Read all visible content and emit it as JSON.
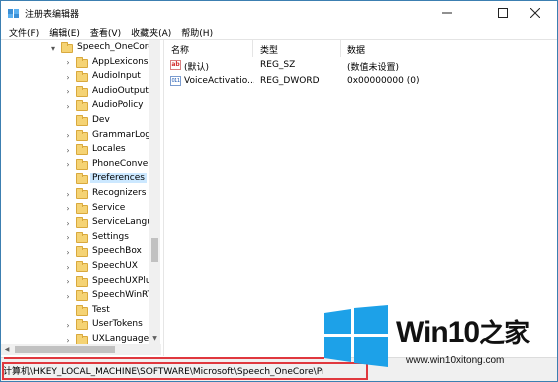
{
  "window": {
    "title": "注册表编辑器",
    "accent": "#3c7fb1"
  },
  "menu": [
    {
      "label": "文件(F)"
    },
    {
      "label": "编辑(E)"
    },
    {
      "label": "查看(V)"
    },
    {
      "label": "收藏夹(A)"
    },
    {
      "label": "帮助(H)"
    }
  ],
  "tree": {
    "parent": "Speech_OneCore",
    "children": [
      "AppLexicons",
      "AudioInput",
      "AudioOutput",
      "AudioPolicy",
      "Dev",
      "GrammarLog",
      "Locales",
      "PhoneConver",
      "Preferences",
      "Recognizers",
      "Service",
      "ServiceLangu",
      "Settings",
      "SpeechBox",
      "SpeechUX",
      "SpeechUXPlu",
      "SpeechWinRT",
      "Test",
      "UserTokens",
      "UXLanguages"
    ],
    "selected": "Preferences"
  },
  "list": {
    "headers": {
      "name": "名称",
      "type": "类型",
      "data": "数据"
    },
    "rows": [
      {
        "icon": "string-value-icon",
        "icon_text": "ab",
        "name": "(默认)",
        "type": "REG_SZ",
        "data": "(数值未设置)"
      },
      {
        "icon": "dword-value-icon",
        "icon_text": "011",
        "name": "VoiceActivatio...",
        "type": "REG_DWORD",
        "data": "0x00000000 (0)"
      }
    ]
  },
  "statusbar": {
    "path": "计算机\\HKEY_LOCAL_MACHINE\\SOFTWARE\\Microsoft\\Speech_OneCore\\Preferences",
    "highlight_color": "#e0383e"
  },
  "watermark": {
    "brand": "Win10",
    "brand_suffix": "之家",
    "url": "www.win10xitong.com",
    "logo_color": "#1da1e8"
  }
}
